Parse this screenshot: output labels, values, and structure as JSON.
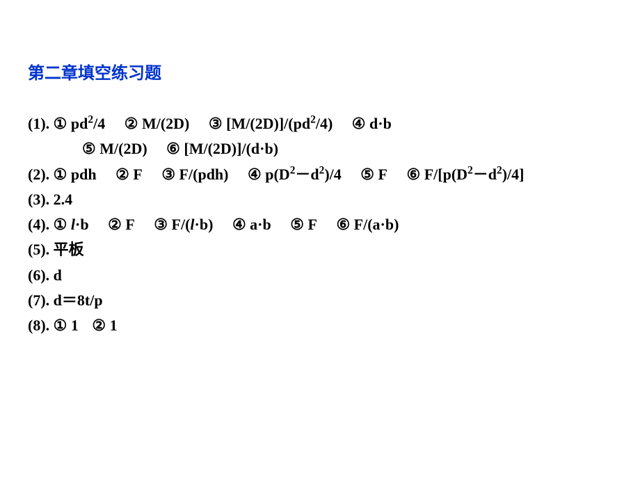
{
  "title": "第二章填空练习题",
  "items": {
    "q1": {
      "num": "(1).",
      "a1_label": "①",
      "a1": "πd²/4",
      "a2_label": "②",
      "a2": "M/(2D)",
      "a3_label": "③",
      "a3": "[M/(2D)]/(πd²/4)",
      "a4_label": "④",
      "a4": "d·b",
      "a5_label": "⑤",
      "a5": "M/(2D)",
      "a6_label": "⑥",
      "a6": "[M/(2D)]/(d·b)"
    },
    "q2": {
      "num": "(2).",
      "a1_label": "①",
      "a1": "πdh",
      "a2_label": "②",
      "a2": "F",
      "a3_label": "③",
      "a3": "F/(πdh)",
      "a4_label": "④",
      "a4": "π(D²－d²)/4",
      "a5_label": "⑤",
      "a5": "F",
      "a6_label": "⑥",
      "a6": "F/[π(D²－d²)/4]"
    },
    "q3": {
      "num": "(3).",
      "a": "2.4"
    },
    "q4": {
      "num": "(4).",
      "a1_label": "①",
      "a1_part1": "l",
      "a1_part2": "·b",
      "a2_label": "②",
      "a2": "F",
      "a3_label": "③",
      "a3_part1": "F/(",
      "a3_part2": "l",
      "a3_part3": "·b)",
      "a4_label": "④",
      "a4": "a·b",
      "a5_label": "⑤",
      "a5": "F",
      "a6_label": "⑥",
      "a6": "F/(a·b)"
    },
    "q5": {
      "num": "(5).",
      "a": "平板"
    },
    "q6": {
      "num": "(6).",
      "a": "d"
    },
    "q7": {
      "num": "(7).",
      "a": "d＝8t/π"
    },
    "q8": {
      "num": "(8).",
      "a1_label": "①",
      "a1": "1",
      "a2_label": "②",
      "a2": "1"
    }
  }
}
